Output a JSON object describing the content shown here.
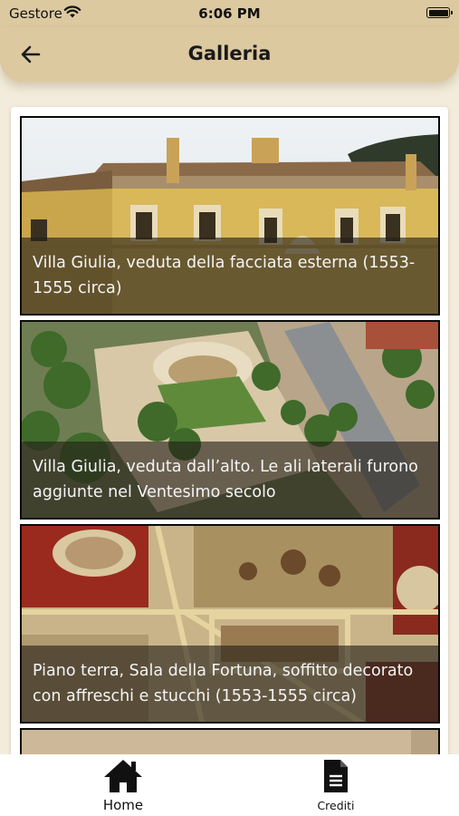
{
  "status_bar": {
    "carrier": "Gestore",
    "time": "6:06 PM"
  },
  "nav": {
    "title": "Galleria"
  },
  "gallery": [
    {
      "caption": "Villa Giulia, veduta della facciata esterna (1553-1555 circa)"
    },
    {
      "caption": "Villa Giulia, veduta dall’alto. Le ali laterali furono aggiunte nel Ventesimo secolo"
    },
    {
      "caption": "Piano terra, Sala della Fortuna, soffitto decorato con affreschi e stucchi (1553-1555 circa)"
    }
  ],
  "tabs": {
    "home": "Home",
    "credits": "Crediti"
  },
  "icons": {
    "back": "arrow-left-icon",
    "home": "house-icon",
    "credits": "document-icon",
    "wifi": "wifi-icon",
    "battery": "battery-icon"
  },
  "colors": {
    "accent": "#dcc9a0",
    "background": "#f3ecdc"
  }
}
